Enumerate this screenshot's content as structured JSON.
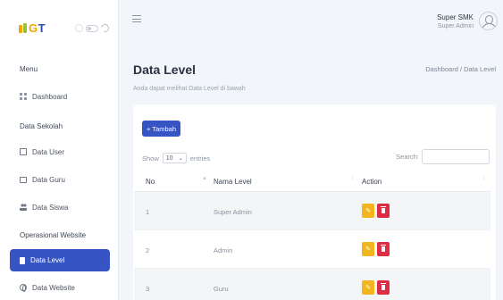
{
  "brand": {
    "g": "G",
    "t": "T"
  },
  "sidebar": {
    "menu_title": "Menu",
    "dashboard": "Dashboard",
    "section_sekolah": "Data Sekolah",
    "data_user": "Data User",
    "data_guru": "Data Guru",
    "data_siswa": "Data Siswa",
    "section_operasional": "Operasional Website",
    "data_level": "Data Level",
    "data_website": "Data Website"
  },
  "header": {
    "user_name": "Super SMK",
    "user_role": "Super Admin"
  },
  "page": {
    "title": "Data Level",
    "subtitle": "Anda dapat melihat Data Level di bawah",
    "breadcrumb": "Dashboard / Data Level"
  },
  "card": {
    "add_label": "+ Tambah",
    "show_label": "Show",
    "entries_value": "10",
    "entries_label": "entries",
    "search_label": "Search:",
    "columns": [
      "No",
      "Nama Level",
      "Action"
    ],
    "rows": [
      {
        "no": "1",
        "name": "Super Admin"
      },
      {
        "no": "2",
        "name": "Admin"
      },
      {
        "no": "3",
        "name": "Guru"
      }
    ]
  },
  "colors": {
    "primary": "#3654c4",
    "edit": "#f2b51d",
    "delete": "#dd2d45"
  }
}
